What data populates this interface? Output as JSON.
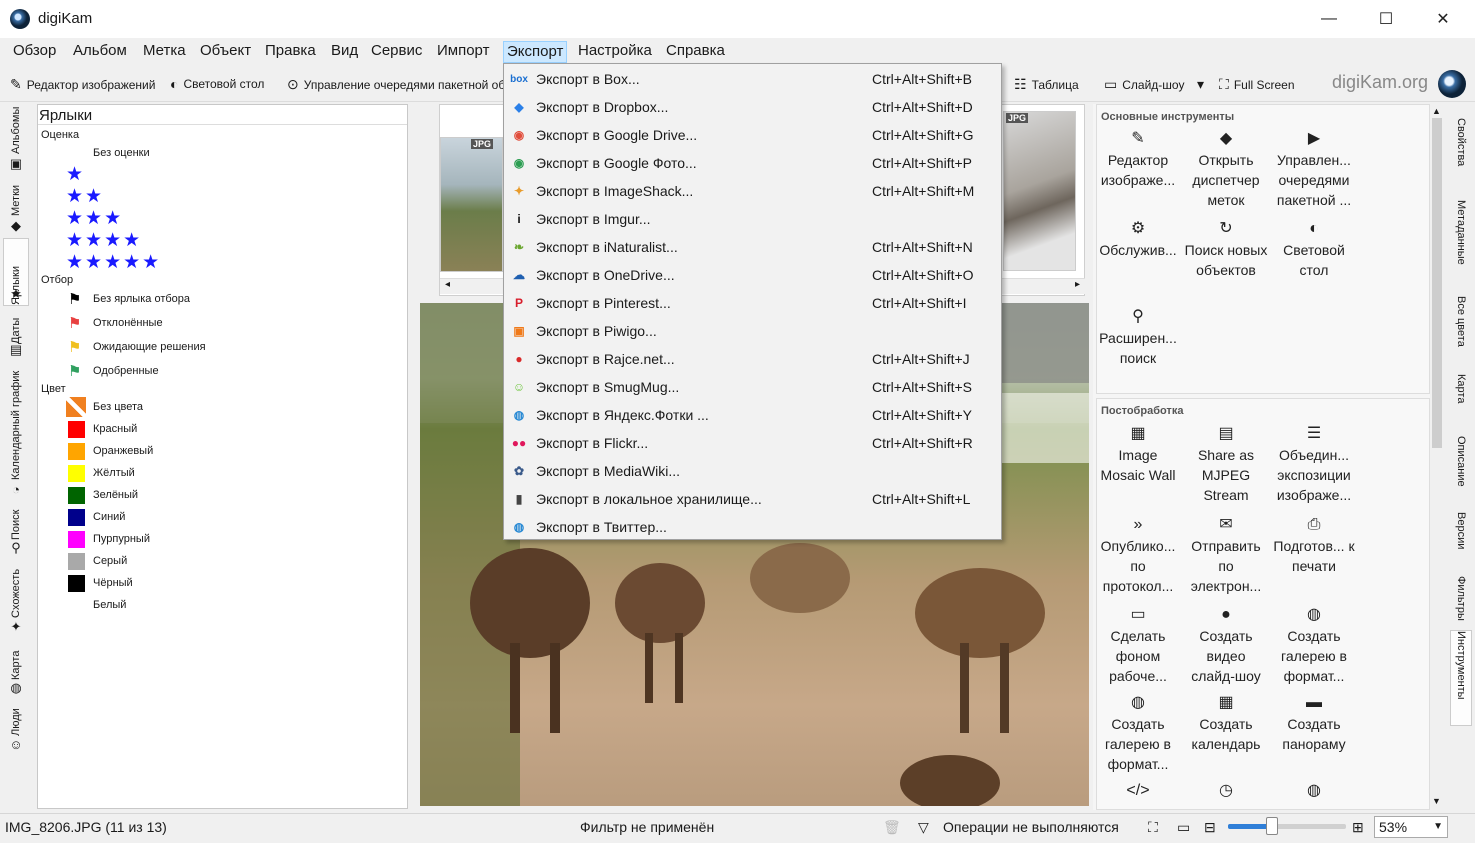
{
  "window": {
    "title": "digiKam",
    "minimize": "—",
    "maximize": "☐",
    "close": "✕"
  },
  "menubar": [
    {
      "id": "overview",
      "label": "Обзор"
    },
    {
      "id": "album",
      "label": "Альбом"
    },
    {
      "id": "tag",
      "label": "Метка"
    },
    {
      "id": "object",
      "label": "Объект"
    },
    {
      "id": "edit",
      "label": "Правка"
    },
    {
      "id": "view",
      "label": "Вид"
    },
    {
      "id": "service",
      "label": "Сервис"
    },
    {
      "id": "import",
      "label": "Импорт"
    },
    {
      "id": "export",
      "label": "Экспорт"
    },
    {
      "id": "settings",
      "label": "Настройка"
    },
    {
      "id": "help",
      "label": "Справка"
    }
  ],
  "toolbar": {
    "image_editor": "Редактор изображений",
    "light_table": "Световой стол",
    "batch_queue": "Управление очередями пакетной обра",
    "table": "Таблица",
    "slideshow": "Слайд-шоу",
    "fullscreen": "Full Screen",
    "brand": "digiKam.org"
  },
  "left_tabs": [
    "Альбомы",
    "Метки",
    "Ярлыки",
    "Даты",
    "Календарный график",
    "Поиск",
    "Схожесть",
    "Карта",
    "Люди"
  ],
  "labels_panel": {
    "header": "Ярлыки",
    "rating_title": "Оценка",
    "no_rating": "Без оценки",
    "stars": [
      "★",
      "★★",
      "★★★",
      "★★★★",
      "★★★★★"
    ],
    "pick_title": "Отбор",
    "picks": [
      {
        "label": "Без ярлыка отбора",
        "color": "#000000"
      },
      {
        "label": "Отклонённые",
        "color": "#e84040"
      },
      {
        "label": "Ожидающие решения",
        "color": "#f0c020"
      },
      {
        "label": "Одобренные",
        "color": "#30a060"
      }
    ],
    "color_title": "Цвет",
    "colors": [
      {
        "label": "Без цвета",
        "color": "#f08020"
      },
      {
        "label": "Красный",
        "color": "#ff0000"
      },
      {
        "label": "Оранжевый",
        "color": "#ffa500"
      },
      {
        "label": "Жёлтый",
        "color": "#ffff00"
      },
      {
        "label": "Зелёный",
        "color": "#006400"
      },
      {
        "label": "Синий",
        "color": "#00008b"
      },
      {
        "label": "Пурпурный",
        "color": "#ff00ff"
      },
      {
        "label": "Серый",
        "color": "#a9a9a9"
      },
      {
        "label": "Чёрный",
        "color": "#000000"
      },
      {
        "label": "Белый",
        "color": "#ffffff"
      }
    ]
  },
  "thumbs": {
    "badge": "JPG"
  },
  "export_menu": [
    {
      "label": "Экспорт в Box...",
      "shortcut": "Ctrl+Alt+Shift+B",
      "icon": "box",
      "icolor": "#1a6fd1"
    },
    {
      "label": "Экспорт в Dropbox...",
      "shortcut": "Ctrl+Alt+Shift+D",
      "icon": "◆",
      "icolor": "#2b80e8"
    },
    {
      "label": "Экспорт в Google Drive...",
      "shortcut": "Ctrl+Alt+Shift+G",
      "icon": "◉",
      "icolor": "#e14d3b"
    },
    {
      "label": "Экспорт в Google Фото...",
      "shortcut": "Ctrl+Alt+Shift+P",
      "icon": "◉",
      "icolor": "#2c9e52"
    },
    {
      "label": "Экспорт в ImageShack...",
      "shortcut": "Ctrl+Alt+Shift+M",
      "icon": "✦",
      "icolor": "#e89b2a"
    },
    {
      "label": "Экспорт в Imgur...",
      "shortcut": "",
      "icon": "i",
      "icolor": "#111111"
    },
    {
      "label": "Экспорт в iNaturalist...",
      "shortcut": "Ctrl+Alt+Shift+N",
      "icon": "❧",
      "icolor": "#6aa62f"
    },
    {
      "label": "Экспорт в OneDrive...",
      "shortcut": "Ctrl+Alt+Shift+O",
      "icon": "☁",
      "icolor": "#1f5fb0"
    },
    {
      "label": "Экспорт в Pinterest...",
      "shortcut": "Ctrl+Alt+Shift+I",
      "icon": "P",
      "icolor": "#d81e2c"
    },
    {
      "label": "Экспорт в Piwigo...",
      "shortcut": "",
      "icon": "▣",
      "icolor": "#f07a1a"
    },
    {
      "label": "Экспорт в Rajce.net...",
      "shortcut": "Ctrl+Alt+Shift+J",
      "icon": "●",
      "icolor": "#d92a2a"
    },
    {
      "label": "Экспорт в SmugMug...",
      "shortcut": "Ctrl+Alt+Shift+S",
      "icon": "☺",
      "icolor": "#6ec63e"
    },
    {
      "label": "Экспорт в Яндекс.Фотки ...",
      "shortcut": "Ctrl+Alt+Shift+Y",
      "icon": "◍",
      "icolor": "#2a8ad4"
    },
    {
      "label": "Экспорт в Flickr...",
      "shortcut": "Ctrl+Alt+Shift+R",
      "icon": "●●",
      "icolor": "#e0185c"
    },
    {
      "label": "Экспорт в MediaWiki...",
      "shortcut": "",
      "icon": "✿",
      "icolor": "#3a5a8a"
    },
    {
      "label": "Экспорт в локальное хранилище...",
      "shortcut": "Ctrl+Alt+Shift+L",
      "icon": "▮",
      "icolor": "#444444"
    },
    {
      "label": "Экспорт в Твиттер...",
      "shortcut": "",
      "icon": "◍",
      "icolor": "#2a8ad4"
    }
  ],
  "tools_panel": {
    "main_title": "Основные инструменты",
    "main_tools": [
      {
        "icon": "✎",
        "label": "Редактор изображе..."
      },
      {
        "icon": "◆",
        "label": "Открыть диспетчер меток"
      },
      {
        "icon": "▶",
        "label": "Управлен... очередями пакетной ..."
      },
      {
        "icon": "⚙",
        "label": "Обслужив..."
      },
      {
        "icon": "↻",
        "label": "Поиск новых объектов"
      },
      {
        "icon": "◐",
        "label": "Световой стол"
      },
      {
        "icon": "⚲",
        "label": "Расширен... поиск"
      }
    ],
    "post_title": "Постобработка",
    "post_tools": [
      {
        "icon": "▦",
        "label": "Image Mosaic Wall"
      },
      {
        "icon": "▤",
        "label": "Share as MJPEG Stream"
      },
      {
        "icon": "☰",
        "label": "Объедин... экспозиции изображе..."
      },
      {
        "icon": "»",
        "label": "Опублико... по протокол..."
      },
      {
        "icon": "✉",
        "label": "Отправить по электрон..."
      },
      {
        "icon": "⎙",
        "label": "Подготов... к печати"
      },
      {
        "icon": "▭",
        "label": "Сделать фоном рабоче..."
      },
      {
        "icon": "●",
        "label": "Создать видео слайд-шоу"
      },
      {
        "icon": "◍",
        "label": "Создать галерею в формат..."
      },
      {
        "icon": "◍",
        "label": "Создать галерею в формат..."
      },
      {
        "icon": "▦",
        "label": "Создать календарь"
      },
      {
        "icon": "▬",
        "label": "Создать панораму"
      },
      {
        "icon": "</>",
        "label": ""
      },
      {
        "icon": "◷",
        "label": ""
      },
      {
        "icon": "◍",
        "label": ""
      }
    ]
  },
  "right_tabs": [
    "Свойства",
    "Метаданные",
    "Все цвета",
    "Карта",
    "Описание",
    "Версии",
    "Фильтры",
    "Инструменты"
  ],
  "status": {
    "file": "IMG_8206.JPG (11 из 13)",
    "filter": "Фильтр не применён",
    "ops": "Операции не выполняются",
    "zoom": "53%",
    "zoom_value": 0.53
  }
}
